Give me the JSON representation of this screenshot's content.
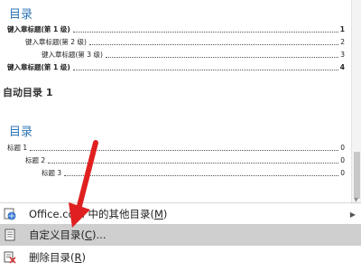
{
  "preview1": {
    "heading": "目录",
    "rows": [
      {
        "label": "键入章标题(第 1 级)",
        "page": "1"
      },
      {
        "label": "键入章标题(第 2 级)",
        "page": "2"
      },
      {
        "label": "键入章标题(第 3 级)",
        "page": "3"
      },
      {
        "label": "键入章标题(第 1 级)",
        "page": "4"
      }
    ]
  },
  "section_title": "自动目录 1",
  "preview2": {
    "heading": "目录",
    "rows": [
      {
        "label": "标题 1",
        "page": "0"
      },
      {
        "label": "标题 2",
        "page": "0"
      },
      {
        "label": "标题 3",
        "page": "0"
      }
    ]
  },
  "menu": {
    "office": {
      "label": "Office.com 中的其他目录(",
      "key": "M",
      "close": ")"
    },
    "custom": {
      "label": "自定义目录(",
      "key": "C",
      "close": ")..."
    },
    "delete": {
      "label": "删除目录(",
      "key": "R",
      "close": ")"
    }
  },
  "colors": {
    "heading": "#2e74b5",
    "arrow": "#e02020",
    "selected": "#cfcfcf"
  }
}
